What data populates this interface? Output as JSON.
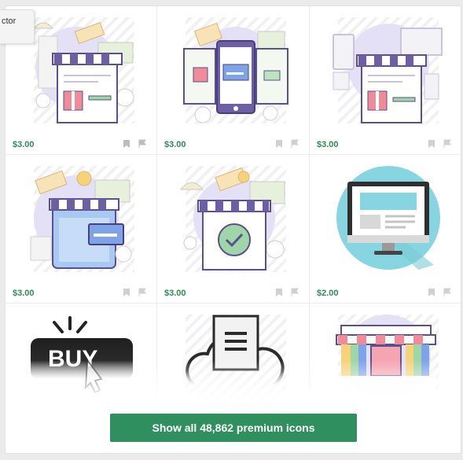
{
  "tooltip": {
    "text": "ctor"
  },
  "items": [
    {
      "price": "$3.00",
      "icon": "online-shop-gift-icon"
    },
    {
      "price": "$3.00",
      "icon": "mobile-shopping-icon"
    },
    {
      "price": "$3.00",
      "icon": "multi-device-shop-icon"
    },
    {
      "price": "$3.00",
      "icon": "tablet-shop-icon"
    },
    {
      "price": "$3.00",
      "icon": "shop-checkmark-icon"
    },
    {
      "price": "$2.00",
      "icon": "desktop-monitor-icon"
    },
    {
      "price": "",
      "icon": "buy-button-icon",
      "text": "BUY"
    },
    {
      "price": "",
      "icon": "cloud-document-icon"
    },
    {
      "price": "",
      "icon": "storefront-icon"
    }
  ],
  "show_all": {
    "label": "Show all 48,862 premium icons"
  },
  "colors": {
    "accent": "#2f8f5e",
    "price": "#2e8b57",
    "purple": "#6c5fa6",
    "lavender": "#e4e0f5",
    "cyan": "#86d5e0"
  }
}
